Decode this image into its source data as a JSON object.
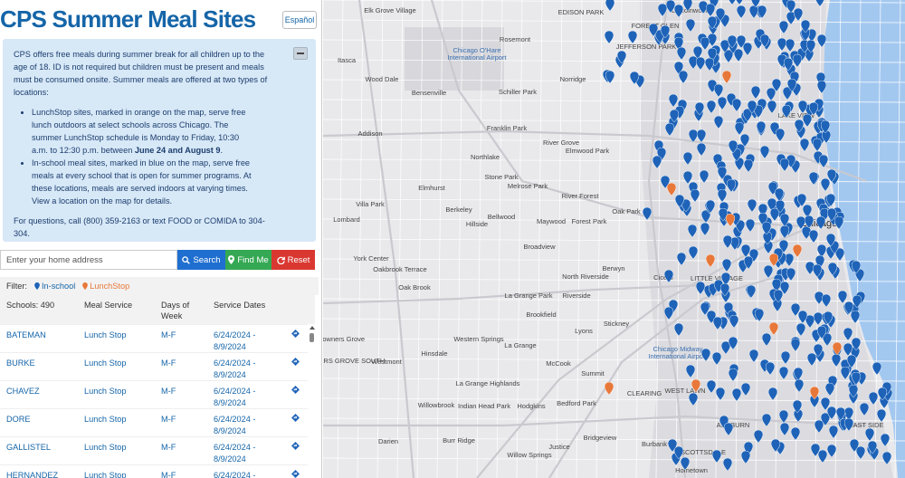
{
  "header": {
    "title": "CPS Summer Meal Sites",
    "language_button": "Español"
  },
  "info": {
    "intro": "CPS offers free meals during summer break for all children up to the age of 18. ID is not required but children must be present and meals must be consumed onsite. Summer meals are offered at two types of locations:",
    "bullet1_pre": "LunchStop sites, marked in orange on the map, serve free lunch outdoors at select schools across Chicago. The summer LunchStop schedule is Monday to Friday, 10:30 a.m. to 12:30 p.m. between ",
    "bullet1_bold": "June 24 and August 9",
    "bullet1_post": ".",
    "bullet2": "In-school meal sites, marked in blue on the map, serve free meals at every school that is open for summer programs. At these locations, meals are served indoors at varying times. View a location on the map for details.",
    "contact": "For questions, call (800) 359-2163 or text FOOD or COMIDA to 304-304."
  },
  "search": {
    "placeholder": "Enter your home address",
    "search_label": "Search",
    "findme_label": "Find Me",
    "reset_label": "Reset"
  },
  "filter": {
    "label": "Filter:",
    "inschool": "In-school",
    "lunchstop": "LunchStop"
  },
  "table": {
    "headers": {
      "schools": "Schools: 490",
      "service": "Meal Service",
      "days": "Days of Week",
      "dates": "Service Dates"
    },
    "rows": [
      {
        "name": "BATEMAN",
        "service": "Lunch Stop",
        "days": "M-F",
        "dates": "6/24/2024 - 8/9/2024"
      },
      {
        "name": "BURKE",
        "service": "Lunch Stop",
        "days": "M-F",
        "dates": "6/24/2024 - 8/9/2024"
      },
      {
        "name": "CHAVEZ",
        "service": "Lunch Stop",
        "days": "M-F",
        "dates": "6/24/2024 - 8/9/2024"
      },
      {
        "name": "DORE",
        "service": "Lunch Stop",
        "days": "M-F",
        "dates": "6/24/2024 - 8/9/2024"
      },
      {
        "name": "GALLISTEL",
        "service": "Lunch Stop",
        "days": "M-F",
        "dates": "6/24/2024 - 8/9/2024"
      },
      {
        "name": "HERNANDEZ",
        "service": "Lunch Stop",
        "days": "M-F",
        "dates": "6/24/2024 - 8/9/2024"
      }
    ]
  },
  "map": {
    "colors": {
      "water": "#a3c8f0",
      "inschool_pin": "#1e63b8",
      "lunchstop_pin": "#e8783a",
      "road": "#ffffff",
      "highway": "#c9c9cf"
    },
    "places": {
      "chicago": "Chicago",
      "ohare": "Chicago O'Hare International Airport",
      "midway": "Chicago Midway International Airport",
      "elk_grove": "Elk Grove Village",
      "rosemont": "Rosemont",
      "itasca": "Itasca",
      "wood_dale": "Wood Dale",
      "bensenville": "Bensenville",
      "schiller_park": "Schiller Park",
      "norridge": "Norridge",
      "franklin_park": "Franklin Park",
      "river_grove": "River Grove",
      "elmwood_park": "Elmwood Park",
      "northlake": "Northlake",
      "addison": "Addison",
      "stone_park": "Stone Park",
      "melrose_park": "Melrose Park",
      "elmhurst": "Elmhurst",
      "river_forest": "River Forest",
      "villa_park": "Villa Park",
      "oak_park": "Oak Park",
      "berkeley": "Berkeley",
      "bellwood": "Bellwood",
      "hillside": "Hillside",
      "maywood": "Maywood",
      "forest_park": "Forest Park",
      "lombard": "Lombard",
      "broadview": "Broadview",
      "york_center": "York Center",
      "oakbrook_terrace": "Oakbrook Terrace",
      "berwyn": "Berwyn",
      "north_riverside": "North Riverside",
      "cicero": "Cicero",
      "oak_brook": "Oak Brook",
      "la_grange_park": "La Grange Park",
      "riverside": "Riverside",
      "brookfield": "Brookfield",
      "stickney": "Stickney",
      "lyons": "Lyons",
      "downers_grove": "Downers Grove",
      "western_springs": "Western Springs",
      "la_grange": "La Grange",
      "hinsdale": "Hinsdale",
      "downers_grove_south": "DOWNERS GROVE SOUTH",
      "westmont": "Westmont",
      "mccook": "McCook",
      "summit": "Summit",
      "la_grange_highlands": "La Grange Highlands",
      "bedford_park": "Bedford Park",
      "indian_head_park": "Indian Head Park",
      "hodgkins": "Hodgkins",
      "willowbrook": "Willowbrook",
      "darien": "Darien",
      "burr_ridge": "Burr Ridge",
      "justice": "Justice",
      "bridgeview": "Bridgeview",
      "burbank": "Burbank",
      "willow_springs": "Willow Springs",
      "hometown": "Hometown",
      "lincolnwood": "Lincolnwood",
      "lake_view": "LAKE VIEW",
      "forest_glen": "FOREST GLEN",
      "jefferson_park": "JEFFERSON PARK",
      "edison_park": "EDISON PARK",
      "west_lawn": "WEST LAWN",
      "clearing": "CLEARING",
      "scottsdale": "SCOTTSDALE",
      "ashburn": "ASHBURN",
      "little_village": "LITTLE VILLAGE",
      "east_side": "EAST SIDE"
    }
  }
}
